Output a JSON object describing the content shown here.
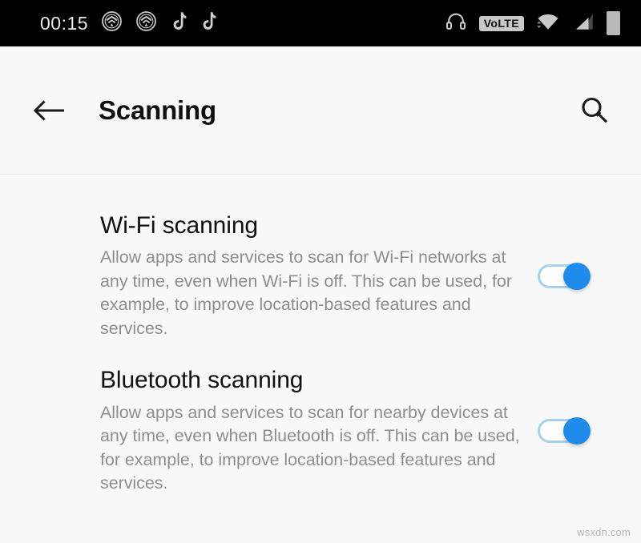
{
  "status_bar": {
    "clock": "00:15",
    "left_icons": [
      {
        "name": "shield-notification-icon",
        "label": "shield"
      },
      {
        "name": "shield-notification-icon-2",
        "label": "shield"
      },
      {
        "name": "tiktok-notification-icon",
        "label": "tiktok"
      },
      {
        "name": "tiktok-notification-icon-2",
        "label": "tiktok"
      }
    ],
    "right_icons": [
      {
        "name": "headset-icon",
        "label": "headset"
      },
      {
        "name": "volte-badge",
        "label": "VoLTE"
      },
      {
        "name": "wifi-icon",
        "label": "wifi"
      },
      {
        "name": "cellular-signal-icon",
        "label": "signal"
      },
      {
        "name": "battery-icon",
        "label": "battery"
      }
    ],
    "volte_label": "VoLTE",
    "background_color": "#000000"
  },
  "app_bar": {
    "back_label": "Back",
    "title": "Scanning",
    "search_label": "Search"
  },
  "settings": {
    "items": [
      {
        "title": "Wi-Fi scanning",
        "description": "Allow apps and services to scan for Wi-Fi networks at any time, even when Wi-Fi is off. This can be used, for example, to improve location-based features and services.",
        "toggle_state": "on"
      },
      {
        "title": "Bluetooth scanning",
        "description": "Allow apps and services to scan for nearby devices at any time, even when Bluetooth is off. This can be used, for example, to improve location-based features and services.",
        "toggle_state": "on"
      }
    ]
  },
  "watermark": {
    "text": "wsxdn.com"
  },
  "colors": {
    "accent": "#1f8cec",
    "track_on": "#a7cfee",
    "background": "#f8f8f8",
    "title_text": "#111111",
    "secondary_text": "#8e8e8e"
  }
}
